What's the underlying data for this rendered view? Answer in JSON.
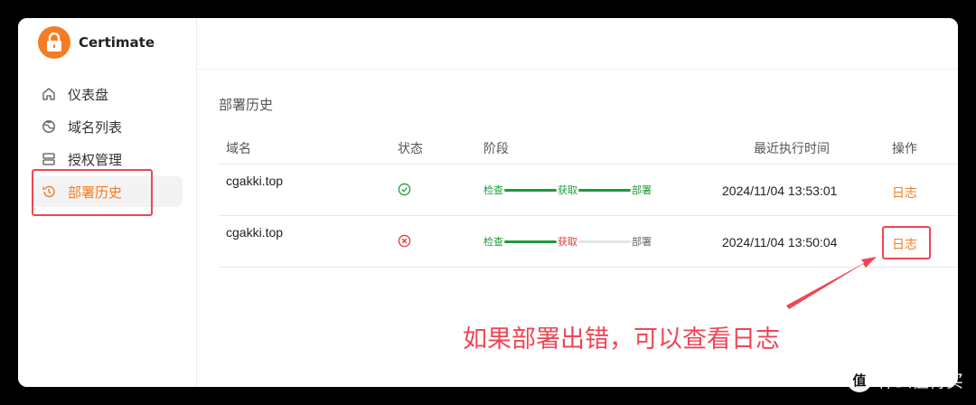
{
  "app": {
    "name": "Certimate"
  },
  "sidebar": {
    "items": [
      {
        "label": "仪表盘",
        "icon": "home-icon"
      },
      {
        "label": "域名列表",
        "icon": "globe-icon"
      },
      {
        "label": "授权管理",
        "icon": "server-icon"
      },
      {
        "label": "部署历史",
        "icon": "history-icon",
        "active": true
      }
    ]
  },
  "main": {
    "title": "部署历史",
    "table": {
      "headers": {
        "domain": "域名",
        "status": "状态",
        "stage": "阶段",
        "time": "最近执行时间",
        "action": "操作"
      },
      "rows": [
        {
          "domain": "cgakki.top",
          "status": "success",
          "stage": {
            "s1": "检查",
            "s2": "获取",
            "s3": "部署"
          },
          "time": "2024/11/04 13:53:01",
          "action": "日志"
        },
        {
          "domain": "cgakki.top",
          "status": "failed",
          "stage": {
            "s1": "检查",
            "s2": "获取",
            "s3": "部署"
          },
          "time": "2024/11/04 13:50:04",
          "action": "日志"
        }
      ]
    }
  },
  "annotation": {
    "text": "如果部署出错，可以查看日志"
  },
  "watermark": {
    "text": "什么值得买",
    "icon_glyph": "值"
  },
  "colors": {
    "accent": "#f47c24",
    "success": "#1e9b3a",
    "error": "#e53935",
    "highlight": "#ef4655"
  }
}
